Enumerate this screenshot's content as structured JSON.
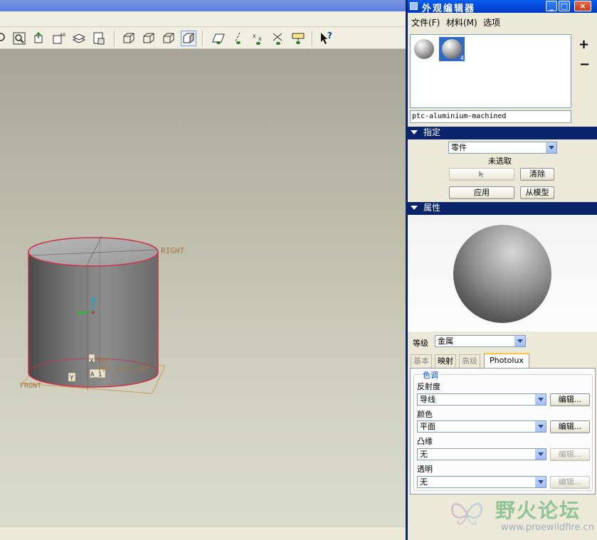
{
  "editor": {
    "title": "外观编辑器",
    "window_buttons": {
      "minimize": "_",
      "maximize": "□",
      "close": "×"
    },
    "menu": [
      "文件(F)",
      "材料(M)",
      "选项"
    ],
    "add_button": "+",
    "remove_button": "−",
    "material_name": "ptc-aluminium-machined",
    "assign": {
      "header": "指定",
      "target_value": "零件",
      "selection_status": "未选取",
      "clear_button": "清除",
      "apply_button": "应用",
      "from_model_button": "从模型"
    },
    "properties": {
      "header": "属性",
      "class_label": "等级",
      "class_value": "金属",
      "tabs": [
        "基本",
        "映射",
        "高级",
        "Photolux"
      ],
      "active_tab": "Photolux",
      "group_title": "色调",
      "fields": [
        {
          "label": "反射度",
          "value": "导线",
          "edit": "编辑...",
          "enabled": true
        },
        {
          "label": "颜色",
          "value": "平面",
          "edit": "编辑...",
          "enabled": true
        },
        {
          "label": "凸缘",
          "value": "无",
          "edit": "编辑...",
          "enabled": false
        },
        {
          "label": "透明",
          "value": "无",
          "edit": "编辑...",
          "enabled": false
        }
      ]
    }
  },
  "viewport": {
    "datum_labels": {
      "right": "RIGHT",
      "top": "TOP",
      "front": "FRONT",
      "csys": "PRT_CSYS_DEF",
      "axis_x": "X",
      "axis_y": "Y",
      "axis_a": "A_1"
    }
  },
  "toolbar": {
    "help_glyph": "?"
  },
  "watermark": {
    "title": "野火论坛",
    "url": "www.proewildfire.cn"
  },
  "colors": {
    "editor_title_bar": "#0046d6",
    "section_header": "#0a246a",
    "cad_edge_highlight": "#d0304a",
    "datum_label": "#a07840"
  }
}
